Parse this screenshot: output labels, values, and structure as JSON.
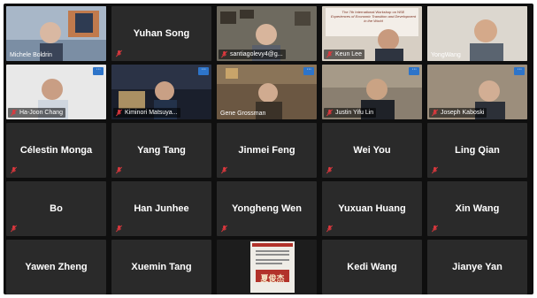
{
  "participants": [
    {
      "name": "Michele Boldrin",
      "video": true
    },
    {
      "name": "Yuhan Song",
      "video": false
    },
    {
      "name": "santiagolevy4@g...",
      "video": true
    },
    {
      "name": "Keun Lee",
      "video": true
    },
    {
      "name": "YongWang",
      "video": true
    },
    {
      "name": "Ha-Joon Chang",
      "video": true
    },
    {
      "name": "Kiminori Matsuya...",
      "video": true
    },
    {
      "name": "Gene Grossman",
      "video": true
    },
    {
      "name": "Justin Yifu Lin",
      "video": true
    },
    {
      "name": "Joseph Kaboski",
      "video": true
    },
    {
      "name": "Célestin Monga",
      "video": false
    },
    {
      "name": "Yang Tang",
      "video": false
    },
    {
      "name": "Jinmei Feng",
      "video": false
    },
    {
      "name": "Wei You",
      "video": false
    },
    {
      "name": "Ling Qian",
      "video": false
    },
    {
      "name": "Bo",
      "video": false
    },
    {
      "name": "Han Junhee",
      "video": false
    },
    {
      "name": "Yongheng Wen",
      "video": false
    },
    {
      "name": "Yuxuan Huang",
      "video": false
    },
    {
      "name": "Xin Wang",
      "video": false
    },
    {
      "name": "Yawen Zheng",
      "video": false
    },
    {
      "name": "Xuemin Tang",
      "video": false
    },
    {
      "name": "",
      "video": true
    },
    {
      "name": "Kedi Wang",
      "video": false
    },
    {
      "name": "Jianye Yan",
      "video": false
    }
  ],
  "slide": {
    "heading": "The 7th International Workshop on NSE",
    "subheading": "Experiences of Economic Transition and Development in the World"
  },
  "poster": {
    "caption": "夏俊杰"
  },
  "more_label": "···",
  "colors": {
    "background": "#0f0f0f",
    "tile": "#2a2a2a",
    "muted": "#e0383e",
    "active_border": "#e9d24a",
    "more_button": "#2d74c9"
  },
  "icons": {
    "muted": "mic-muted-icon",
    "more": "more-options-icon"
  }
}
